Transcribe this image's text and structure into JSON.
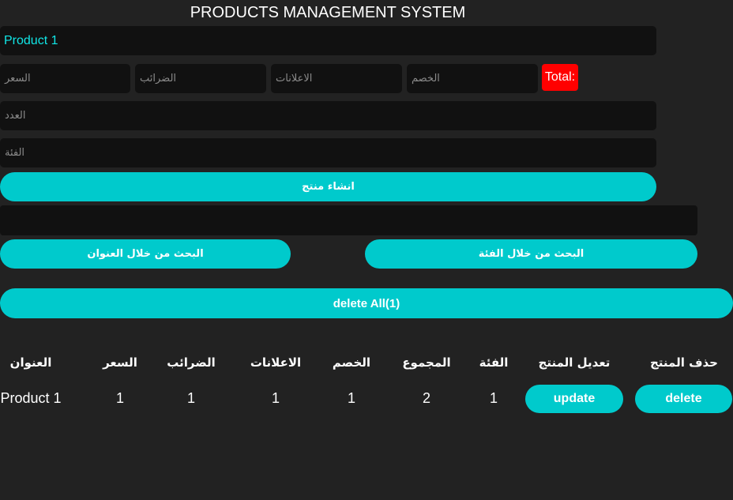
{
  "header": {
    "title": "PRODUCTS MANAGEMENT SYSTEM"
  },
  "form": {
    "name_value": "Product 1",
    "price_placeholder": "السعر",
    "taxes_placeholder": "الضرائب",
    "ads_placeholder": "الاعلانات",
    "discount_placeholder": "الخصم",
    "total_label": "Total:",
    "count_placeholder": "العدد",
    "category_placeholder": "الفئة",
    "create_button": "انشاء منتج"
  },
  "search": {
    "value": "",
    "by_title_button": "البحث من خلال العنوان",
    "by_category_button": "البحث من خلال الفئة"
  },
  "actions": {
    "delete_all_button": "delete All(1)"
  },
  "colors": {
    "accent": "#00cacc",
    "total_bg": "#ff0000",
    "name_text": "#11e6e6",
    "page_bg": "#222222",
    "field_bg": "#111111"
  },
  "table": {
    "headers": [
      "العنوان",
      "السعر",
      "الضرائب",
      "الاعلانات",
      "الخصم",
      "المجموع",
      "الفئة",
      "تعديل المنتج",
      "حذف المنتج"
    ],
    "rows": [
      {
        "title": "Product 1",
        "price": "1",
        "taxes": "1",
        "ads": "1",
        "discount": "1",
        "total": "2",
        "category": "1",
        "update_label": "update",
        "delete_label": "delete"
      }
    ]
  }
}
